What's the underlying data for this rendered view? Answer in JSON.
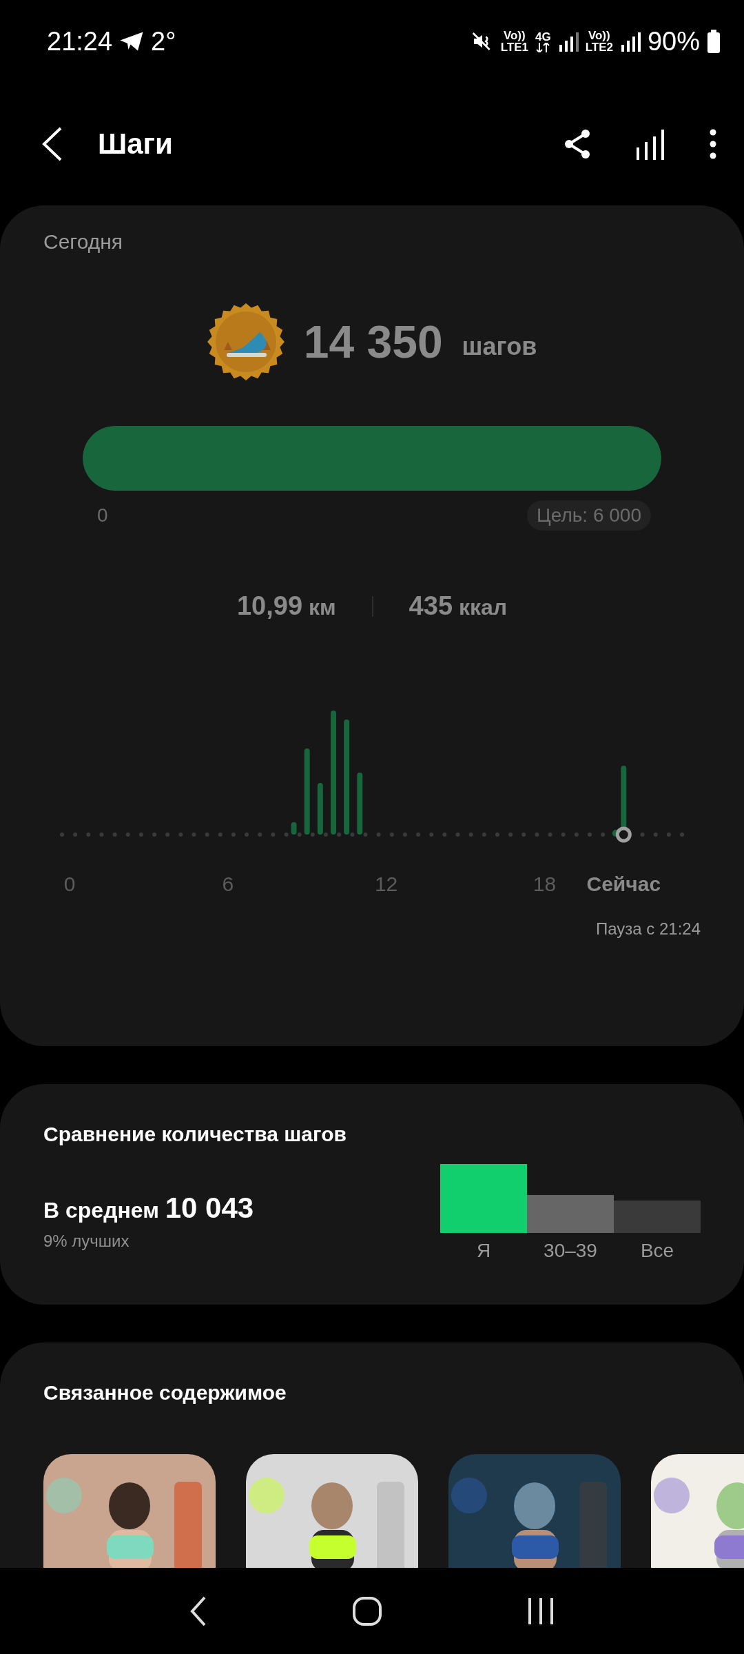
{
  "status_bar": {
    "time": "21:24",
    "temperature": "2°",
    "volte_1": "Vo))",
    "sim_1": "LTE1",
    "data_type": "4G",
    "volte_2": "Vo))",
    "sim_2": "LTE2",
    "battery": "90%"
  },
  "header": {
    "title": "Шаги"
  },
  "today": {
    "label": "Сегодня",
    "steps": "14 350",
    "unit": "шагов",
    "progress": {
      "level": 1,
      "start": "0",
      "goal": "Цель: 6 000"
    },
    "distance": {
      "value": "10,99",
      "unit": "км"
    },
    "calories": {
      "value": "435",
      "unit": "ккал"
    },
    "timeline": {
      "ticks": [
        "0",
        "6",
        "12",
        "18"
      ],
      "now": "Сейчас"
    },
    "pause": "Пауза с 21:24"
  },
  "comparison": {
    "title": "Сравнение количества шагов",
    "average_label": "В среднем",
    "average": "10 043",
    "rank": "9% лучших",
    "groups": [
      {
        "label": "Я",
        "color": "#12cf6e"
      },
      {
        "label": "30–39",
        "color": "#666666"
      },
      {
        "label": "Все",
        "color": "#3a3a3a"
      }
    ]
  },
  "related": {
    "title": "Связанное содержимое"
  }
}
